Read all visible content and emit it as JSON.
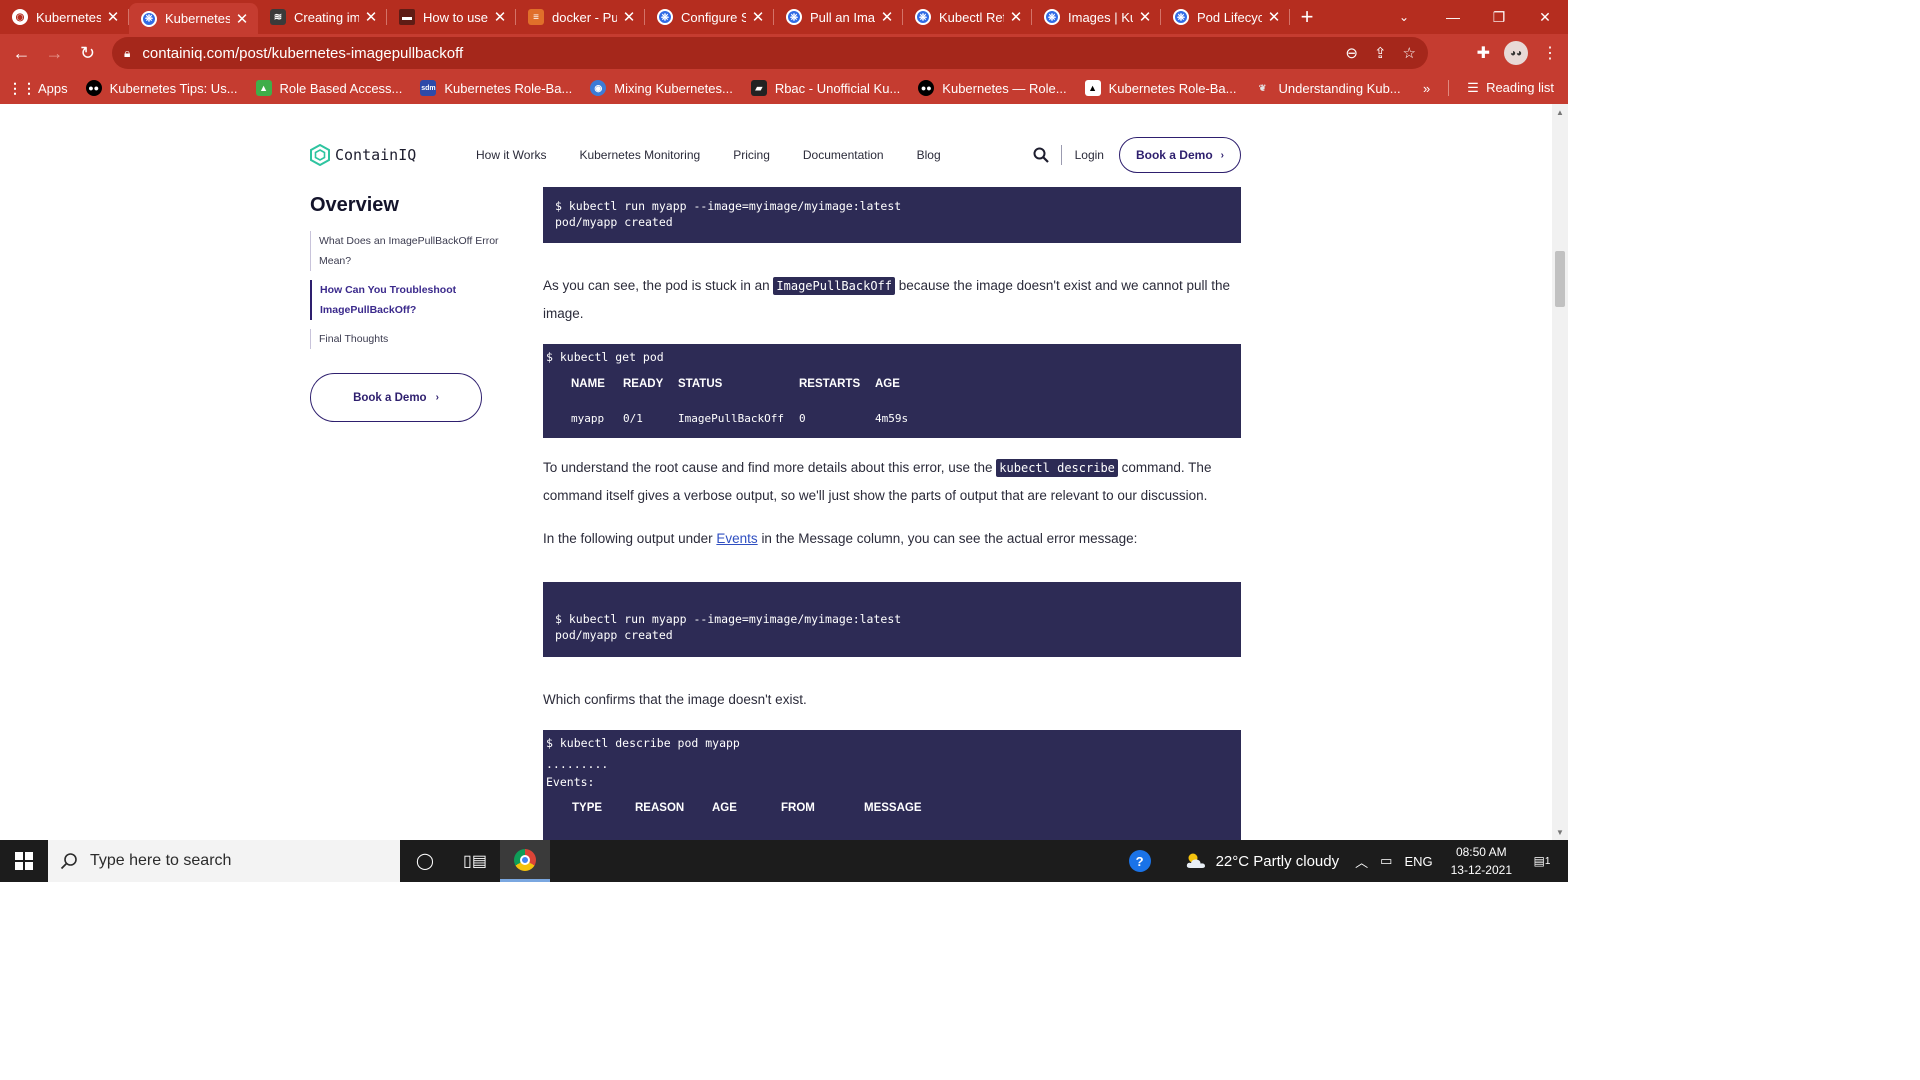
{
  "browser": {
    "tabs": [
      {
        "title": "Kubernetes",
        "favicon": "globe-icon",
        "active": false
      },
      {
        "title": "Kubernetes",
        "favicon": "kubernetes-icon",
        "active": true
      },
      {
        "title": "Creating im",
        "favicon": "dark-icon",
        "active": false
      },
      {
        "title": "How to use",
        "favicon": "doc-icon",
        "active": false
      },
      {
        "title": "docker - Pu",
        "favicon": "docker-icon",
        "active": false
      },
      {
        "title": "Configure S",
        "favicon": "kubernetes-icon",
        "active": false
      },
      {
        "title": "Pull an Imag",
        "favicon": "kubernetes-icon",
        "active": false
      },
      {
        "title": "Kubectl Ref",
        "favicon": "kubernetes-icon",
        "active": false
      },
      {
        "title": "Images | Ku",
        "favicon": "kubernetes-icon",
        "active": false
      },
      {
        "title": "Pod Lifecyc",
        "favicon": "kubernetes-icon",
        "active": false
      }
    ],
    "url": "containiq.com/post/kubernetes-imagepullbackoff",
    "bookmarks": [
      {
        "label": "Apps",
        "icon": "apps-grid-icon"
      },
      {
        "label": "Kubernetes Tips: Us...",
        "icon": "medium-icon"
      },
      {
        "label": "Role Based Access...",
        "icon": "green-square-icon"
      },
      {
        "label": "Kubernetes Role-Ba...",
        "icon": "sdm-icon"
      },
      {
        "label": "Mixing Kubernetes...",
        "icon": "user-icon"
      },
      {
        "label": "Rbac - Unofficial Ku...",
        "icon": "book-icon"
      },
      {
        "label": "Kubernetes — Role...",
        "icon": "medium-icon"
      },
      {
        "label": "Kubernetes Role-Ba...",
        "icon": "triangle-icon"
      },
      {
        "label": "Understanding Kub...",
        "icon": "feather-icon"
      }
    ],
    "reading_list": "Reading list",
    "theme_color": "#c53c30"
  },
  "site": {
    "brand": "ContainIQ",
    "nav": [
      "How it Works",
      "Kubernetes Monitoring",
      "Pricing",
      "Documentation",
      "Blog"
    ],
    "login": "Login",
    "cta": "Book a Demo",
    "accent_color": "#2e1f6e"
  },
  "sidebar": {
    "title": "Overview",
    "toc": [
      {
        "label": "What Does an ImagePullBackOff Error Mean?",
        "active": false
      },
      {
        "label": "How Can You Troubleshoot ImagePullBackOff?",
        "active": true
      },
      {
        "label": "Final Thoughts",
        "active": false
      }
    ],
    "cta": "Book a Demo"
  },
  "article": {
    "code1": [
      "$ kubectl run myapp --image=myimage/myimage:latest",
      "pod/myapp created"
    ],
    "p1": {
      "before": "As you can see, the pod is stuck in an",
      "code": "ImagePullBackOff",
      "after": "because the image doesn't exist and we cannot pull the image."
    },
    "code2": {
      "command": "$ kubectl get pod",
      "headers": [
        "NAME",
        "READY",
        "STATUS",
        "RESTARTS",
        "AGE"
      ],
      "row": [
        "myapp",
        "0/1",
        "ImagePullBackOff",
        "0",
        "4m59s"
      ]
    },
    "p2": {
      "before": "To understand the root cause and find more details about this error, use the",
      "code": "kubectl describe",
      "after": "command. The command itself gives a verbose output, so we'll just show the parts of output that are relevant to our discussion."
    },
    "p3": {
      "before": "In the following output under",
      "link": "Events",
      "after": "in the Message column, you can see the actual error message:"
    },
    "code3": [
      "$ kubectl run myapp --image=myimage/myimage:latest",
      "pod/myapp created"
    ],
    "p4": "Which confirms that the image doesn't exist.",
    "code4": {
      "command": "$ kubectl describe pod myapp",
      "dots": ".........",
      "events": "Events:",
      "headers": [
        "TYPE",
        "REASON",
        "AGE",
        "FROM",
        "MESSAGE"
      ]
    },
    "code_bg": "#2d2b55"
  },
  "taskbar": {
    "search_placeholder": "Type here to search",
    "weather": "22°C  Partly cloudy",
    "language": "ENG",
    "time": "08:50 AM",
    "date": "13-12-2021",
    "notifications": "1"
  }
}
